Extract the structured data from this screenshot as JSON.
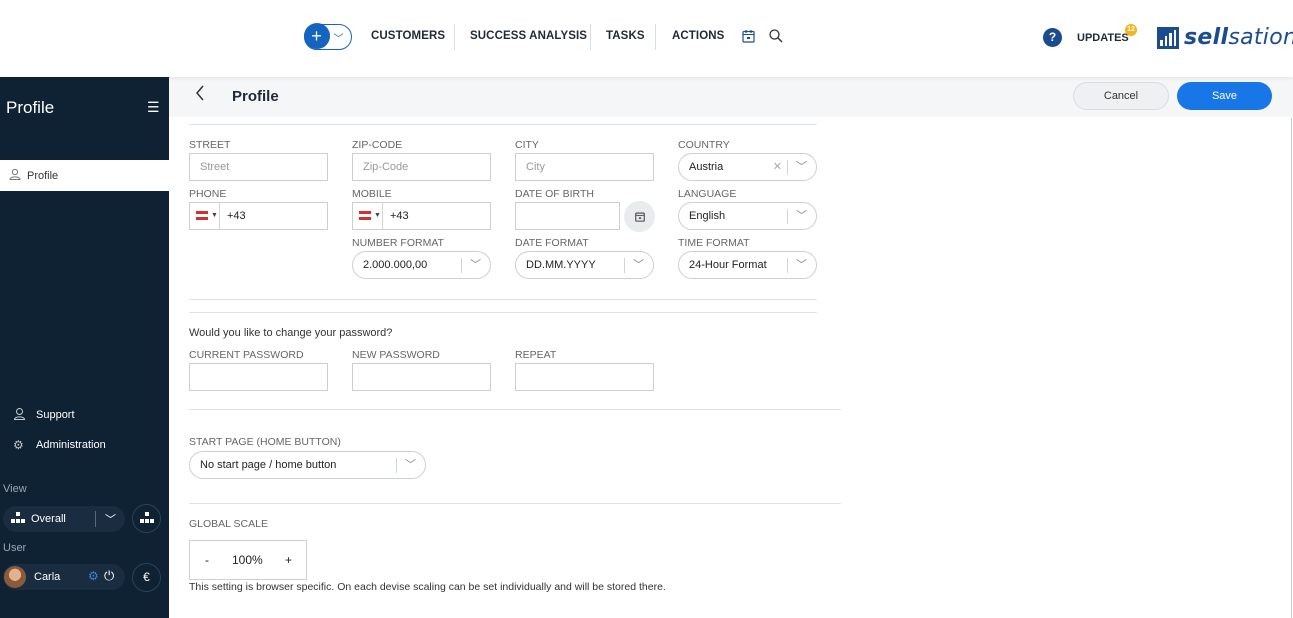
{
  "nav": {
    "add_icon": "plus-icon",
    "items": [
      "CUSTOMERS",
      "SUCCESS ANALYSIS",
      "TASKS",
      "ACTIONS"
    ],
    "calendar_icon": "calendar-icon",
    "search_icon": "search-icon",
    "help": "?",
    "updates": "UPDATES",
    "updates_count": "12",
    "logo_bold": "sell",
    "logo_rest": "sation"
  },
  "sidebar": {
    "title": "Profile",
    "menu_icon": "hamburger-icon",
    "active_item": "Profile",
    "support": "Support",
    "administration": "Administration",
    "view_label": "View",
    "view_value": "Overall",
    "user_label": "User",
    "user_name": "Carla",
    "currency": "€"
  },
  "header": {
    "title": "Profile",
    "cancel": "Cancel",
    "save": "Save"
  },
  "form": {
    "street": {
      "label": "STREET",
      "placeholder": "Street"
    },
    "zip": {
      "label": "ZIP-CODE",
      "placeholder": "Zip-Code"
    },
    "city": {
      "label": "CITY",
      "placeholder": "City"
    },
    "country": {
      "label": "COUNTRY",
      "value": "Austria"
    },
    "phone": {
      "label": "PHONE",
      "value": "+43"
    },
    "mobile": {
      "label": "MOBILE",
      "value": "+43"
    },
    "dob": {
      "label": "DATE OF BIRTH",
      "value": ""
    },
    "language": {
      "label": "LANGUAGE",
      "value": "English"
    },
    "number_format": {
      "label": "NUMBER FORMAT",
      "value": "2.000.000,00"
    },
    "date_format": {
      "label": "DATE FORMAT",
      "value": "DD.MM.YYYY"
    },
    "time_format": {
      "label": "TIME FORMAT",
      "value": "24-Hour Format"
    }
  },
  "password": {
    "question": "Would you like to change your password?",
    "current": "CURRENT PASSWORD",
    "new": "NEW PASSWORD",
    "repeat": "REPEAT"
  },
  "start_page": {
    "label": "START PAGE (HOME BUTTON)",
    "value": "No start page / home button"
  },
  "scale": {
    "label": "GLOBAL SCALE",
    "minus": "-",
    "value": "100%",
    "plus": "+",
    "note": "This setting is browser specific. On each devise scaling can be set individually and will be stored there."
  },
  "colors": {
    "sidebar_bg": "#0f2233",
    "accent": "#1976e6",
    "brand": "#1a4c8f"
  }
}
